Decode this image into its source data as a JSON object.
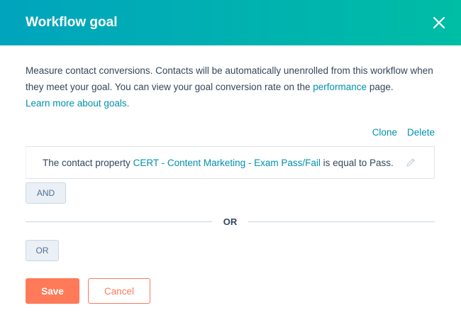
{
  "header": {
    "title": "Workflow goal",
    "close_icon": "close-icon"
  },
  "description": {
    "text_part1": "Measure contact conversions. Contacts will be automatically unenrolled from this workflow when they meet your goal. You can view your goal conversion rate on the ",
    "performance_link": "performance",
    "text_part2": " page.",
    "learn_more_link": "Learn more about goals."
  },
  "criteria_actions": {
    "clone_label": "Clone",
    "delete_label": "Delete"
  },
  "filter": {
    "prefix": "The contact property ",
    "property_link": "CERT - Content Marketing - Exam Pass/Fail",
    "suffix": " is equal to Pass.",
    "edit_icon": "pencil-icon"
  },
  "and_button": "AND",
  "or_divider": "OR",
  "or_button": "OR",
  "footer": {
    "save_label": "Save",
    "cancel_label": "Cancel"
  },
  "colors": {
    "header_gradient_start": "#00a4bd",
    "header_gradient_end": "#00bda5",
    "link": "#0091ae",
    "primary_button": "#ff7a59",
    "text": "#33475b"
  }
}
